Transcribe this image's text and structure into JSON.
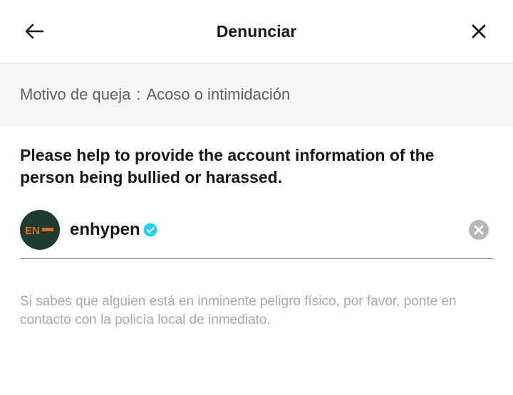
{
  "header": {
    "title": "Denunciar",
    "back_icon": "arrow-left-icon",
    "close_icon": "close-icon"
  },
  "reason": {
    "label": "Motivo de queja",
    "separator": ":",
    "value": "Acoso o intimidación"
  },
  "prompt": {
    "text": "Please help to provide the account information of the person being bullied or harassed."
  },
  "account": {
    "avatar_text": "EN",
    "username": "enhypen",
    "verified_icon": "verified-badge-icon",
    "clear_icon": "clear-circle-icon"
  },
  "disclaimer": {
    "text": "Si sabes que alguien está en inminente peligro físico, por favor, ponte en contacto con la policía local de inmediato."
  },
  "colors": {
    "text_primary": "#161823",
    "text_secondary": "#5e5f66",
    "text_muted": "#a8a9ad",
    "band_bg": "#f6f6f6",
    "verified": "#20d5ec",
    "avatar_bg": "#1f3b32",
    "avatar_logo": "#e8692c"
  }
}
